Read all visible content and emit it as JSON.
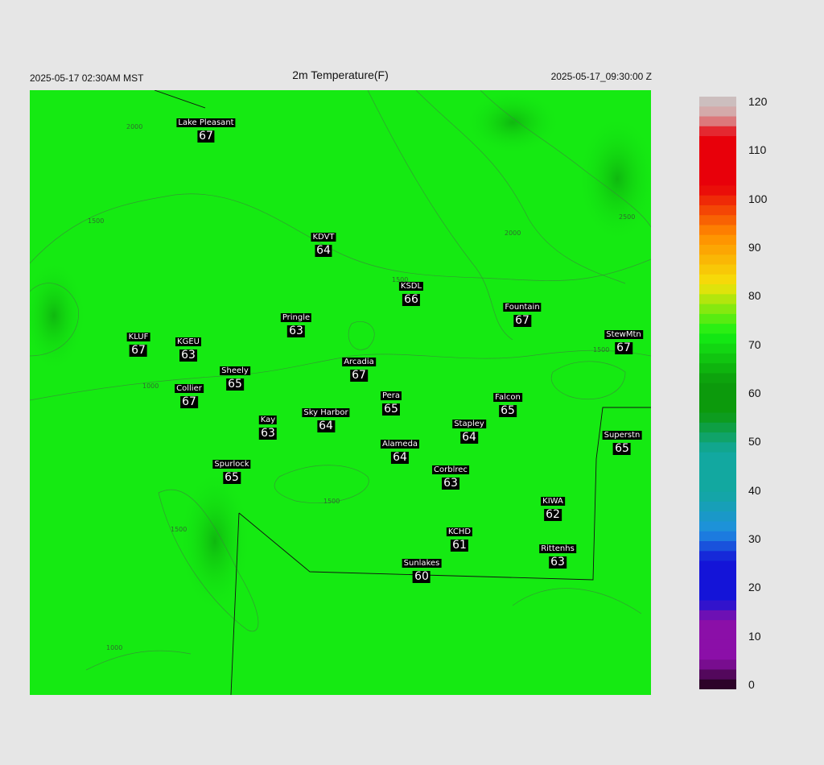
{
  "header": {
    "local_time": "2025-05-17 02:30AM MST",
    "title": "2m Temperature(F)",
    "utc_time": "2025-05-17_09:30:00 Z"
  },
  "stations": [
    {
      "name": "Lake Pleasant",
      "value": "67"
    },
    {
      "name": "KDVT",
      "value": "64"
    },
    {
      "name": "KSDL",
      "value": "66"
    },
    {
      "name": "Fountain",
      "value": "67"
    },
    {
      "name": "StewMtn",
      "value": "67"
    },
    {
      "name": "Pringle",
      "value": "63"
    },
    {
      "name": "KLUF",
      "value": "67"
    },
    {
      "name": "KGEU",
      "value": "63"
    },
    {
      "name": "Arcadia",
      "value": "67"
    },
    {
      "name": "Sheely",
      "value": "65"
    },
    {
      "name": "Collier",
      "value": "67"
    },
    {
      "name": "Pera",
      "value": "65"
    },
    {
      "name": "Falcon",
      "value": "65"
    },
    {
      "name": "Kay",
      "value": "63"
    },
    {
      "name": "Sky Harbor",
      "value": "64"
    },
    {
      "name": "Stapley",
      "value": "64"
    },
    {
      "name": "Superstn",
      "value": "65"
    },
    {
      "name": "Alameda",
      "value": "64"
    },
    {
      "name": "Spurlock",
      "value": "65"
    },
    {
      "name": "Corblrec",
      "value": "63"
    },
    {
      "name": "KIWA",
      "value": "62"
    },
    {
      "name": "KCHD",
      "value": "61"
    },
    {
      "name": "Rittenhs",
      "value": "63"
    },
    {
      "name": "Sunlakes",
      "value": "60"
    }
  ],
  "contour_labels": [
    "2000",
    "1500",
    "1000",
    "2500"
  ],
  "colorbar": {
    "ticks": [
      "120",
      "110",
      "100",
      "90",
      "80",
      "70",
      "60",
      "50",
      "40",
      "30",
      "20",
      "10",
      "0"
    ],
    "min": 0,
    "max": 120,
    "colors": {
      "field": "#15ea12",
      "low": "#1a0010",
      "purple": "#8b0fa8",
      "blue": "#1414d8",
      "sky": "#1e8fe0",
      "teal": "#12a8a0",
      "green_dark": "#0c9a0c",
      "green": "#14f014",
      "yellow": "#f5e10a",
      "orange": "#ff8c00",
      "red": "#e8000a",
      "pink": "#d8a0a0",
      "top": "#c8c8c8"
    }
  }
}
